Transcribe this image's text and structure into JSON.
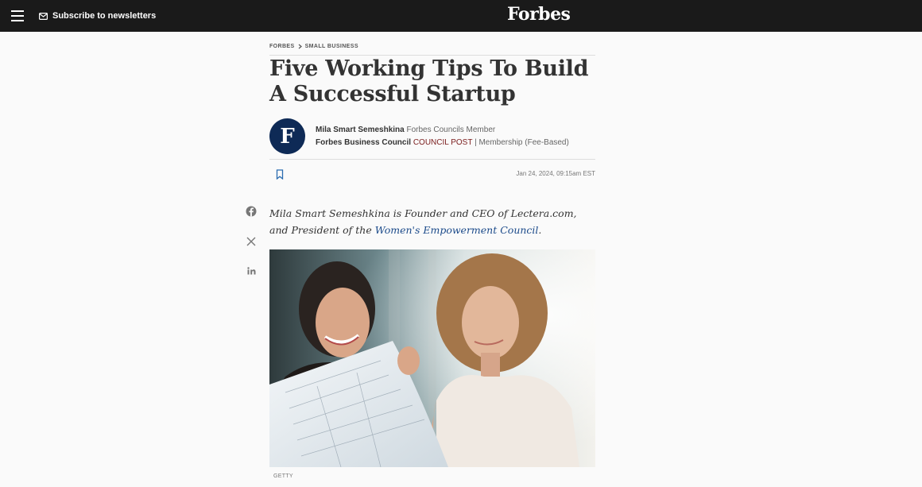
{
  "header": {
    "subscribe_label": "Subscribe to newsletters",
    "logo_text": "Forbes"
  },
  "breadcrumb": {
    "root": "FORBES",
    "section": "SMALL BUSINESS"
  },
  "article": {
    "title": "Five Working Tips To Build A Successful Startup",
    "author": {
      "avatar_letter": "F",
      "name": "Mila Smart Semeshkina",
      "role": "Forbes Councils Member",
      "council": "Forbes Business Council",
      "post_type": "COUNCIL POST",
      "separator": "|",
      "membership": "Membership (Fee-Based)"
    },
    "date": "Jan 24, 2024, 09:15am EST",
    "standfirst_prefix": "Mila Smart Semeshkina is Founder and CEO of Lectera.com, and President of the ",
    "standfirst_link": "Women's Empowerment Council",
    "standfirst_suffix": ".",
    "image_credit": "GETTY"
  },
  "share": [
    "facebook-icon",
    "x-icon",
    "linkedin-icon"
  ],
  "colors": {
    "topbar": "#1a1a1a",
    "avatar": "#0e2a56",
    "council_post": "#7a1c1c",
    "link": "#1b4a8a"
  }
}
